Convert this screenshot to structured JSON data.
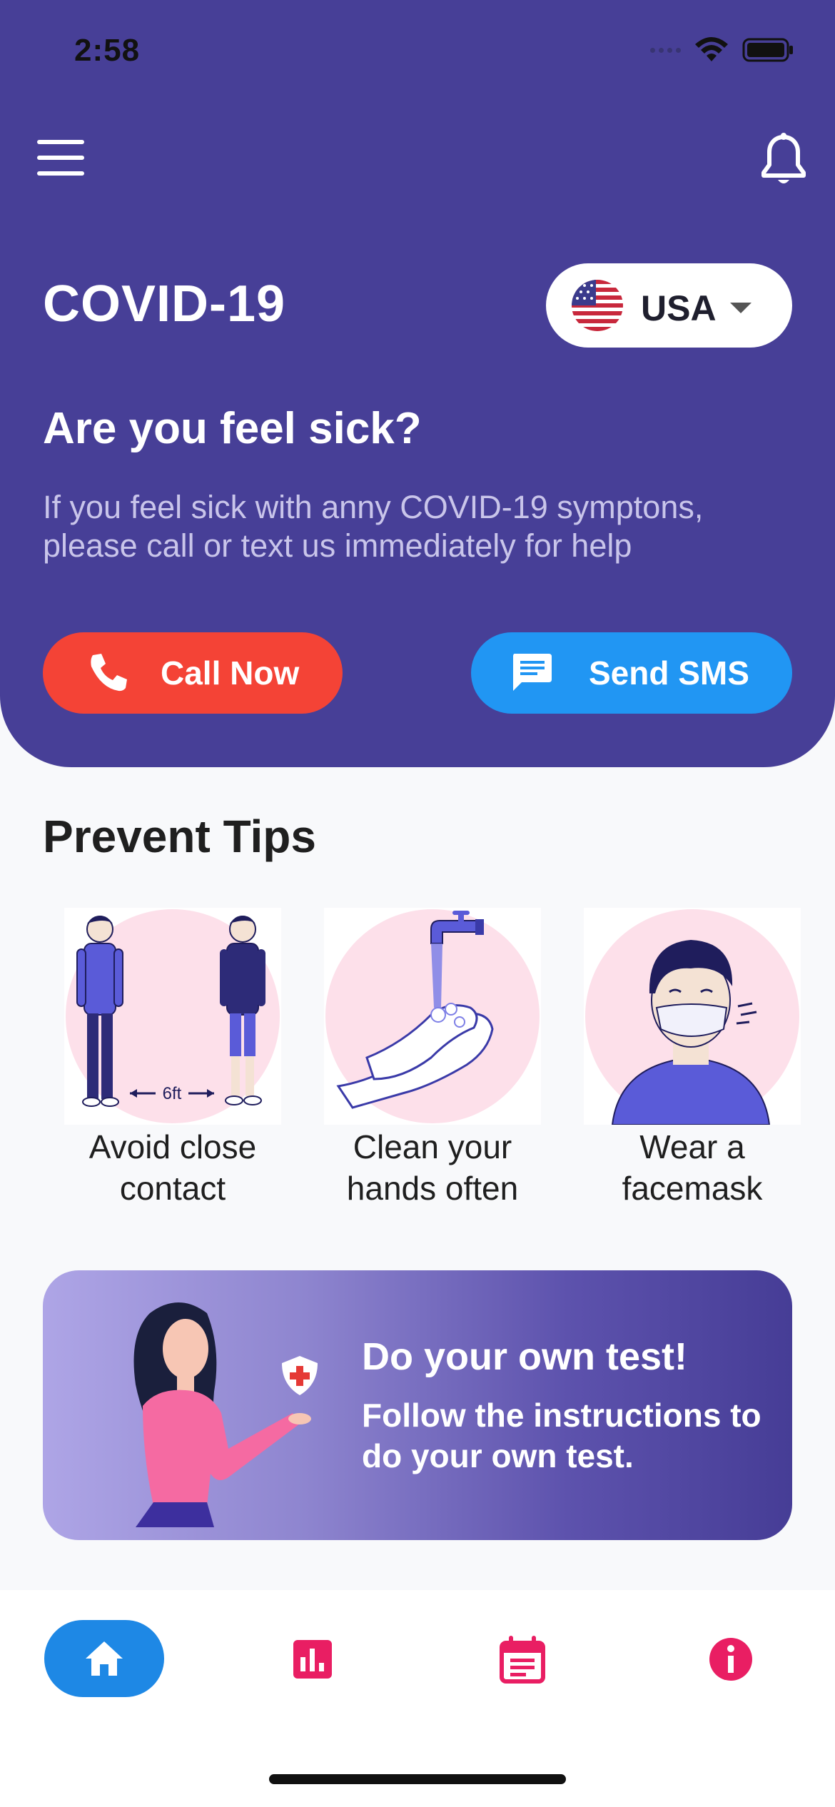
{
  "status_bar": {
    "time": "2:58"
  },
  "header": {
    "app_title": "COVID-19",
    "country": {
      "selected": "USA"
    },
    "sick_title": "Are you feel sick?",
    "sick_description": "If you feel sick with anny COVID-19 symptons, please call or text us immediately for help",
    "call_button": "Call Now",
    "sms_button": "Send SMS"
  },
  "prevent": {
    "title": "Prevent Tips",
    "tips": [
      {
        "label": "Avoid close\ncontact",
        "distance": "6ft"
      },
      {
        "label": "Clean your\nhands often"
      },
      {
        "label": "Wear a\nfacemask"
      }
    ]
  },
  "test_card": {
    "title": "Do your own test!",
    "description": "Follow the instructions to do your own test."
  },
  "bottom_nav": {
    "items": [
      "home-icon",
      "statistics-icon",
      "calendar-icon",
      "info-icon"
    ],
    "active_index": 0
  },
  "colors": {
    "header": "#473f97",
    "call": "#f44336",
    "sms": "#2196f3",
    "nav_active": "#1e88e5",
    "nav_icon": "#e91e63"
  }
}
